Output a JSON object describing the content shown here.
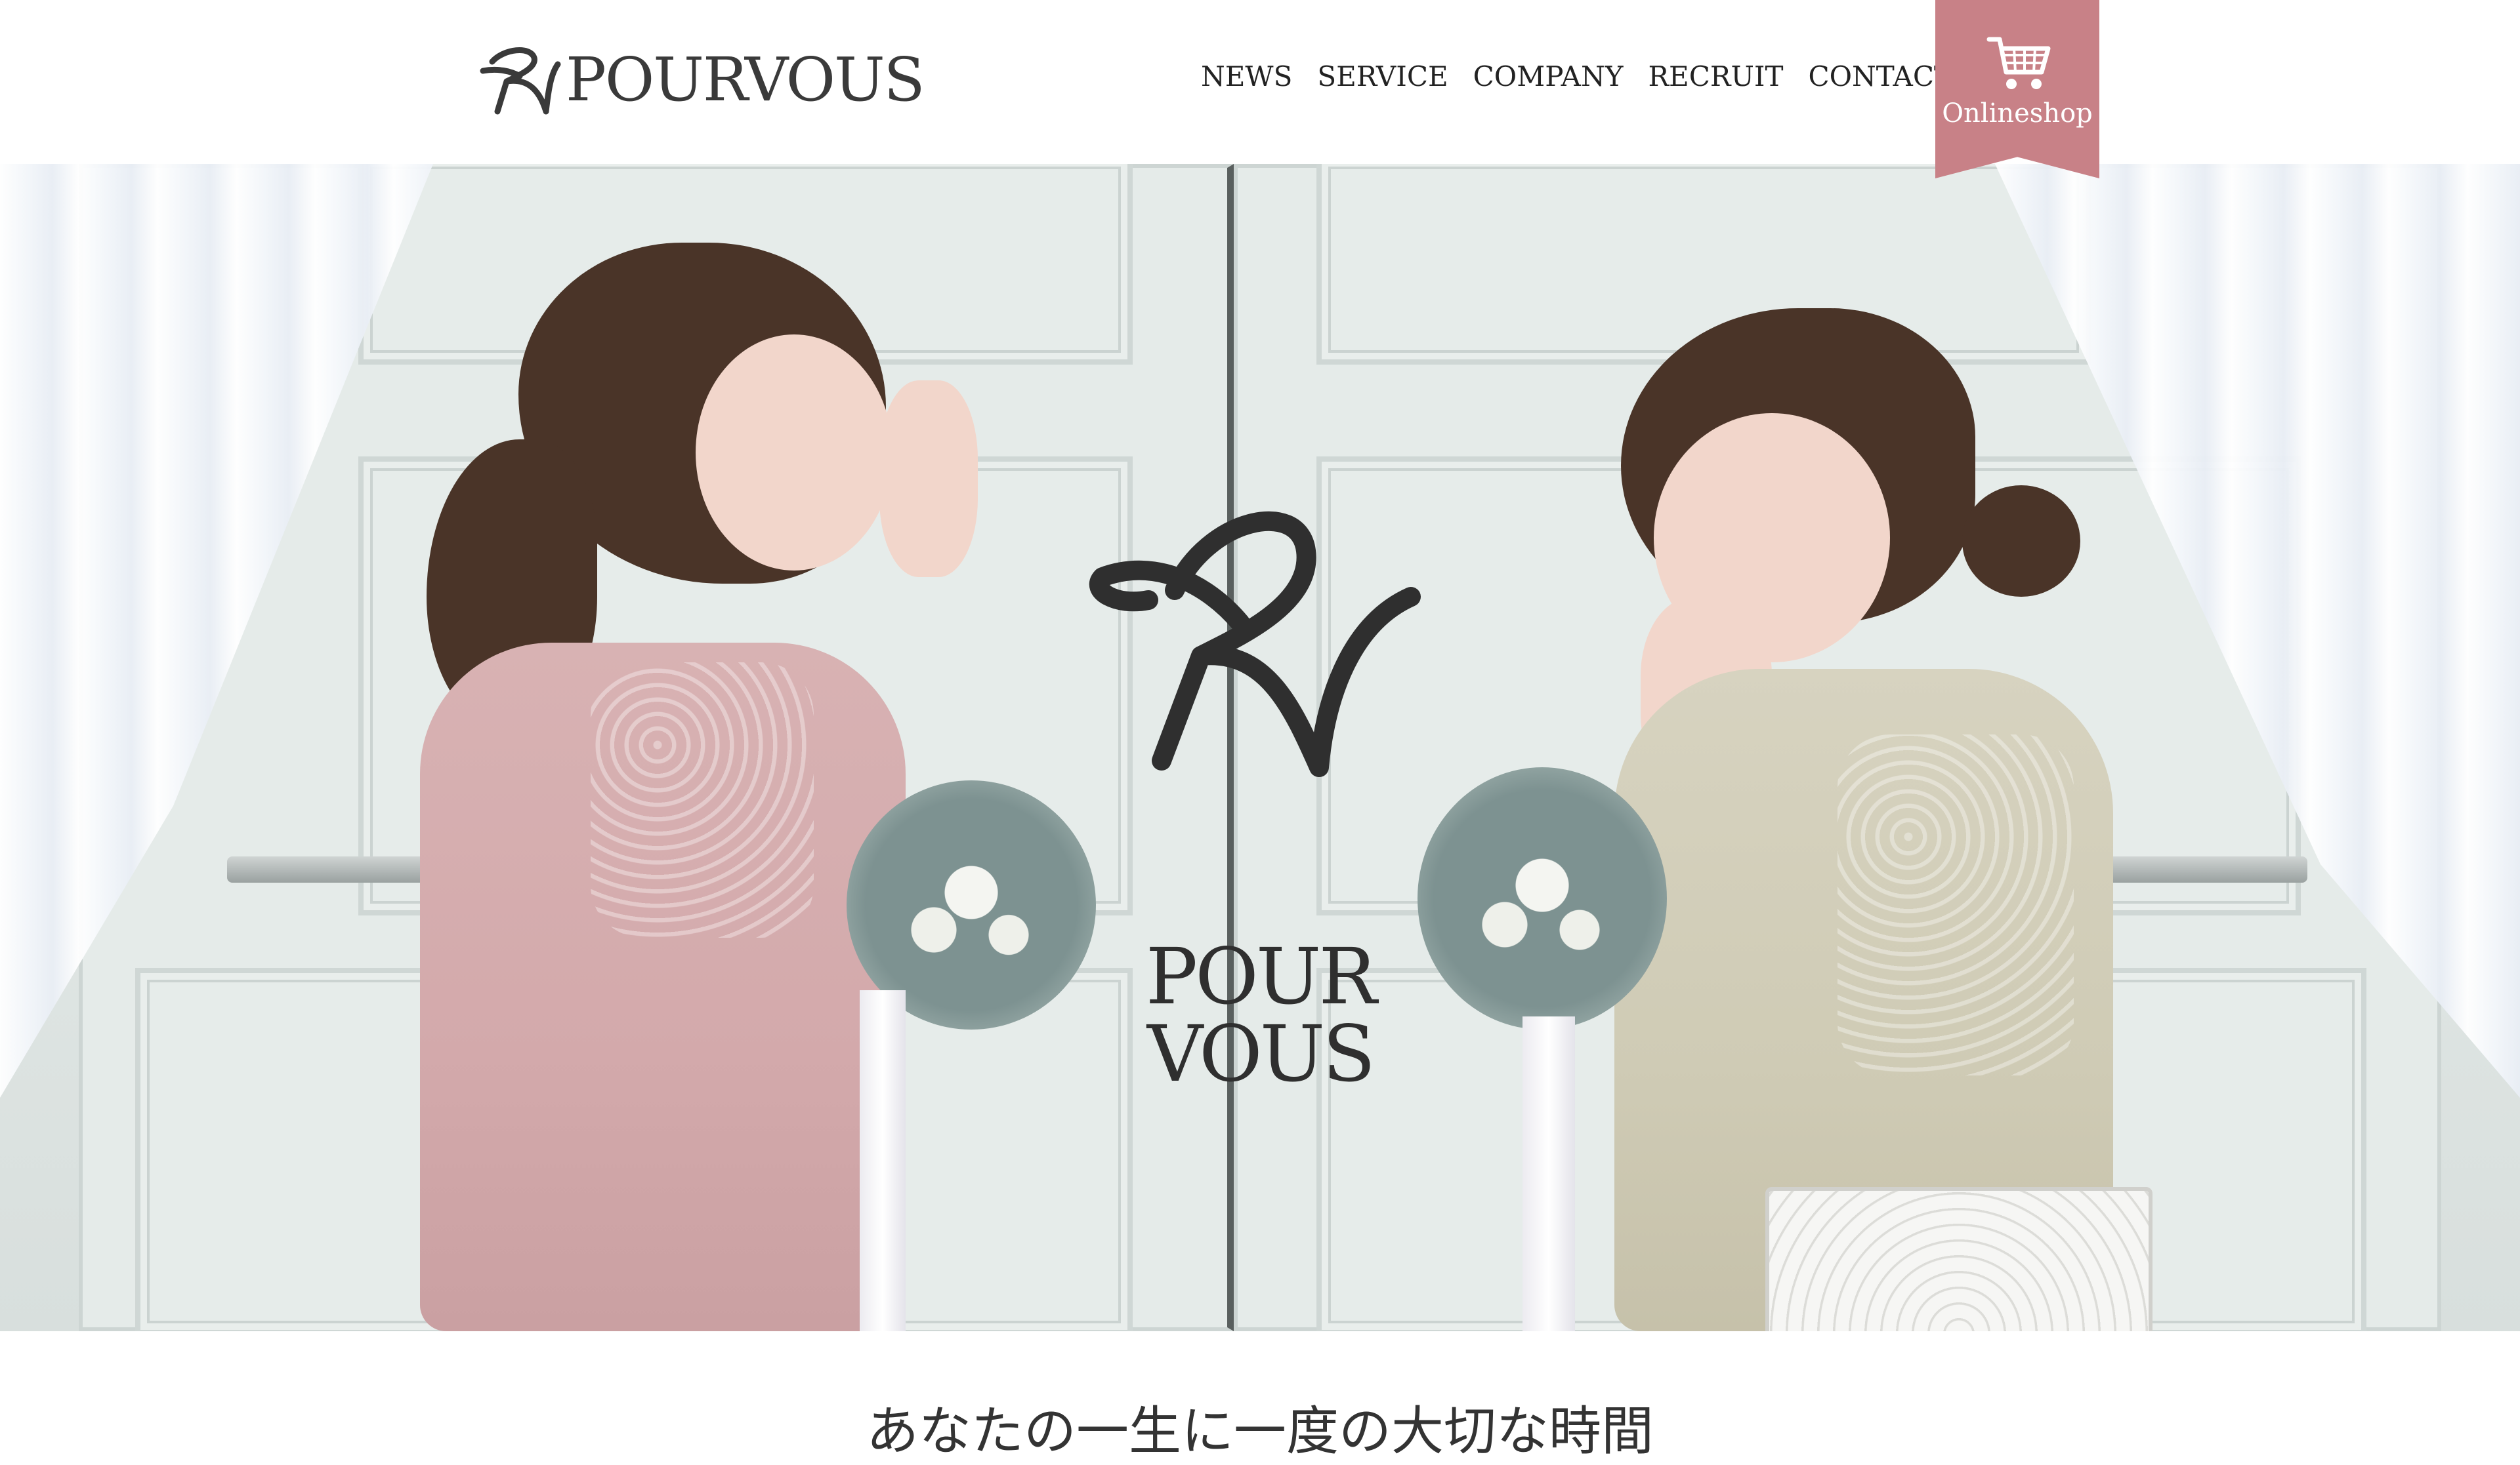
{
  "header": {
    "brand_name": "POURVOUS",
    "nav": [
      {
        "label": "NEWS"
      },
      {
        "label": "SERVICE"
      },
      {
        "label": "COMPANY"
      },
      {
        "label": "RECRUIT"
      },
      {
        "label": "CONTACT"
      }
    ],
    "shop": {
      "label": "Onlineshop",
      "icon": "cart-icon",
      "color": "#c88187"
    }
  },
  "hero": {
    "logo_text": "POUR VOUS"
  },
  "tagline": "あなたの一生に一度の大切な時間"
}
